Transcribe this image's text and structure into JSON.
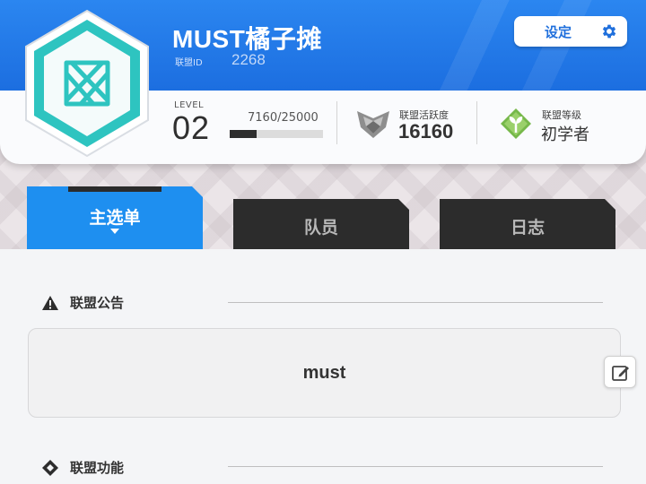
{
  "header": {
    "alliance_name": "MUST橘子摊",
    "id_label": "联盟ID",
    "id_value": "2268",
    "settings_label": "设定",
    "level_label_line1": "LEVEL",
    "level_value": "02",
    "exp_text": "7160/25000",
    "exp_progress": 0.2864,
    "activity_label": "联盟活跃度",
    "activity_value": "16160",
    "rank_label": "联盟等级",
    "rank_value": "初学者"
  },
  "tabs": [
    {
      "label": "主选单",
      "active": true
    },
    {
      "label": "队员",
      "active": false
    },
    {
      "label": "日志",
      "active": false
    }
  ],
  "sections": {
    "announcement_title": "联盟公告",
    "announcement_text": "must",
    "features_title": "联盟功能"
  },
  "colors": {
    "header_blue": "#1c6ee0",
    "active_tab": "#1e8ff0",
    "inactive_tab": "#2c2c2c",
    "emblem_teal": "#2ec4c0"
  },
  "icons": {
    "settings": "gear-icon",
    "announcement": "warning-icon",
    "features": "diamond-icon",
    "edit": "edit-icon",
    "activity": "shield-badge-icon",
    "rank": "sprout-badge-icon"
  }
}
